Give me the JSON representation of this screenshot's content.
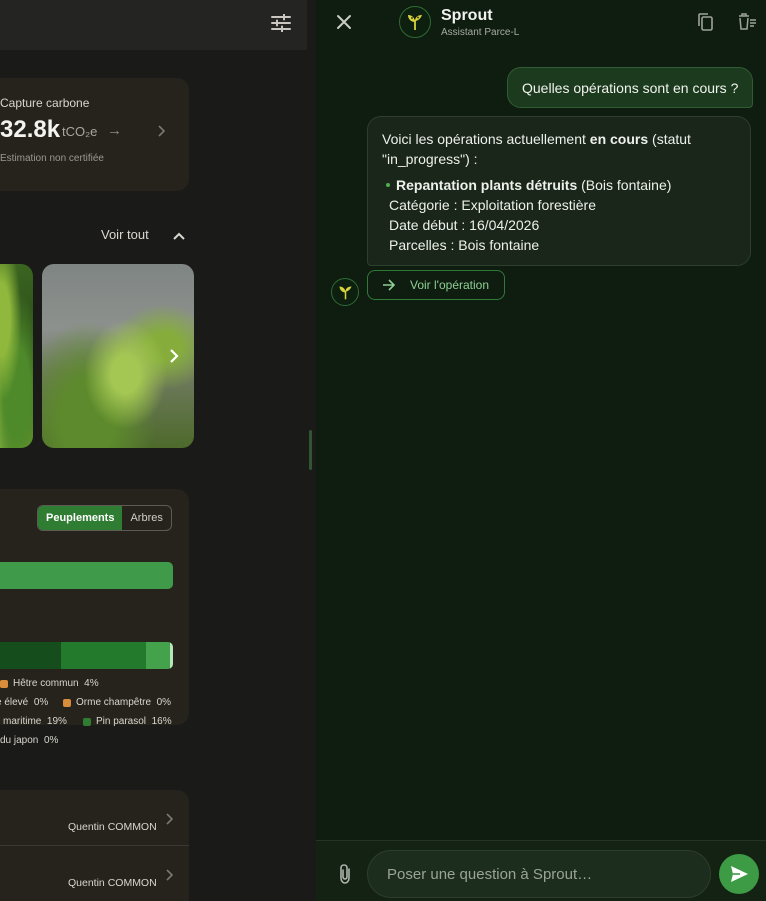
{
  "background_app": {
    "carbon": {
      "label": "Capture carbone",
      "value": "32.8k",
      "unit": "tCO₂e",
      "arrow": "→",
      "note": "Estimation non certifiée"
    },
    "gallery": {
      "see_all": "Voir tout"
    },
    "species": {
      "tabs": [
        {
          "label": "Peuplements",
          "active": true
        },
        {
          "label": "Arbres",
          "active": false
        }
      ],
      "legend": [
        {
          "label": "Hêtre commun",
          "value": "4%",
          "color": "#d98c3a"
        },
        {
          "label": "e élevé",
          "value": "0%",
          "color": ""
        },
        {
          "label": "Orme champêtre",
          "value": "0%",
          "color": "#d98c3a"
        },
        {
          "label": "maritime",
          "value": "19%",
          "color": ""
        },
        {
          "label": "Pin parasol",
          "value": "16%",
          "color": "#2e7d32"
        },
        {
          "label": "du japon",
          "value": "0%",
          "color": ""
        }
      ]
    },
    "list": [
      {
        "owner": "Quentin COMMON"
      },
      {
        "owner": "Quentin COMMON"
      }
    ]
  },
  "chat": {
    "bot_name": "Sprout",
    "bot_subtitle": "Assistant Parce-L",
    "messages": {
      "user": "Quelles opérations sont en cours ?",
      "bot": {
        "intro_pre": "Voici les opérations actuellement ",
        "intro_bold": "en cours",
        "intro_post": " (statut \"in_progress\") :",
        "op_name": "Repantation plants détruits",
        "op_place": " (Bois fontaine)",
        "category": "Catégorie : Exploitation forestière",
        "start_date": "Date début : 16/04/2026",
        "parcels": "Parcelles : Bois fontaine"
      }
    },
    "action_label": "Voir l'opération",
    "input_placeholder": "Poser une question à Sprout…"
  },
  "colors": {
    "accent": "#3d9a45",
    "chat_bg": "#0f1c10",
    "user_bubble": "#1c3a1e"
  }
}
